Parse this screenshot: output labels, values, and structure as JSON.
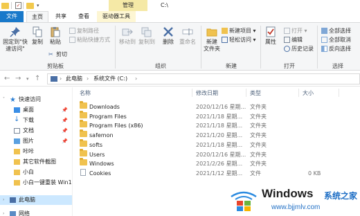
{
  "titlebar": {
    "context_tab": "管理",
    "path_title": "C:\\"
  },
  "ribbon_tabs": {
    "file": "文件",
    "home": "主页",
    "share": "共享",
    "view": "查看",
    "drive_tools": "驱动器工具"
  },
  "ribbon": {
    "clipboard": {
      "pin_quick_access": "固定到\"快\n速访问\"",
      "copy": "复制",
      "paste": "粘贴",
      "copy_path": "复制路径",
      "paste_shortcut": "粘贴快捷方式",
      "cut": "剪切",
      "group": "剪贴板"
    },
    "organize": {
      "move_to": "移动到",
      "copy_to": "复制到",
      "delete": "删除",
      "rename": "重命名",
      "group": "组织"
    },
    "new": {
      "new_folder": "新建\n文件夹",
      "new_item": "新建项目",
      "easy_access": "轻松访问",
      "group": "新建"
    },
    "open": {
      "properties": "属性",
      "open": "打开",
      "edit": "编辑",
      "history": "历史记录",
      "group": "打开"
    },
    "select": {
      "select_all": "全部选择",
      "select_none": "全部取消",
      "invert": "反向选择",
      "group": "选择"
    }
  },
  "address": {
    "segments": [
      "此电脑",
      "系统文件 (C:)"
    ]
  },
  "nav": {
    "items": [
      {
        "label": "快速访问",
        "icon": "star-icon"
      },
      {
        "label": "桌面",
        "icon": "desktop-icon",
        "pinned": true
      },
      {
        "label": "下载",
        "icon": "download-icon",
        "pinned": true
      },
      {
        "label": "文档",
        "icon": "document-icon",
        "pinned": true
      },
      {
        "label": "图片",
        "icon": "picture-icon",
        "pinned": true
      },
      {
        "label": "咔咔",
        "icon": "folder-icon"
      },
      {
        "label": "其它软件截图",
        "icon": "folder-icon"
      },
      {
        "label": "小白",
        "icon": "folder-icon"
      },
      {
        "label": "小白一键重装 Win1",
        "icon": "folder-icon"
      },
      {
        "label": "此电脑",
        "icon": "computer-icon",
        "selected": true
      },
      {
        "label": "网络",
        "icon": "network-icon"
      }
    ]
  },
  "columns": {
    "name": "名称",
    "date": "修改日期",
    "type": "类型",
    "size": "大小"
  },
  "files": [
    {
      "name": "Downloads",
      "date": "2020/12/16 星期...",
      "type": "文件夹",
      "size": "",
      "kind": "folder"
    },
    {
      "name": "Program Files",
      "date": "2021/1/18 星期...",
      "type": "文件夹",
      "size": "",
      "kind": "folder"
    },
    {
      "name": "Program Files (x86)",
      "date": "2021/1/18 星期...",
      "type": "文件夹",
      "size": "",
      "kind": "folder"
    },
    {
      "name": "safemon",
      "date": "2021/1/20 星期...",
      "type": "文件夹",
      "size": "",
      "kind": "folder"
    },
    {
      "name": "softs",
      "date": "2021/1/18 星期...",
      "type": "文件夹",
      "size": "",
      "kind": "folder"
    },
    {
      "name": "Users",
      "date": "2020/12/16 星期...",
      "type": "文件夹",
      "size": "",
      "kind": "folder"
    },
    {
      "name": "Windows",
      "date": "2021/2/26 星期...",
      "type": "文件夹",
      "size": "",
      "kind": "folder"
    },
    {
      "name": "Cookies",
      "date": "2021/1/12 星期...",
      "type": "文件",
      "size": "0 KB",
      "kind": "file"
    }
  ],
  "watermark": {
    "brand": "Windows",
    "cn": "系统之家",
    "url": "www.bjjmlv.com"
  }
}
